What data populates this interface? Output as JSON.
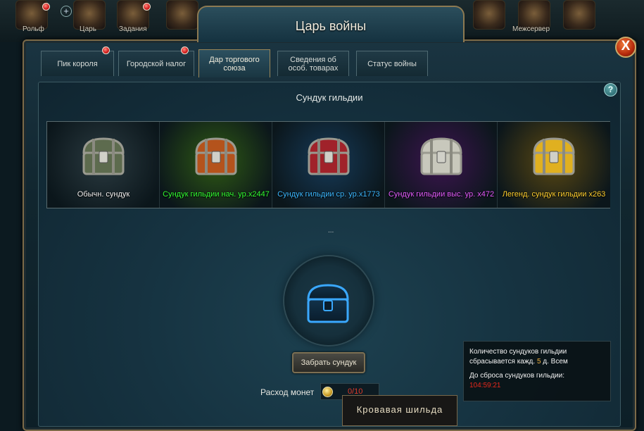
{
  "hud": {
    "labels": [
      "Рольф",
      "Царь",
      "Задания",
      "Межсервер"
    ]
  },
  "window": {
    "title": "Царь войны",
    "close_glyph": "X",
    "help_glyph": "?"
  },
  "tabs": [
    {
      "label": "Пик короля",
      "has_alert": true,
      "active": false
    },
    {
      "label": "Городской налог",
      "has_alert": true,
      "active": false
    },
    {
      "label": "Дар торгового союза",
      "has_alert": false,
      "active": true
    },
    {
      "label": "Сведения об особ. товарах",
      "has_alert": false,
      "active": false
    },
    {
      "label": "Статус войны",
      "has_alert": false,
      "active": false
    }
  ],
  "panel": {
    "title": "Сундук гильдии",
    "dots": "..."
  },
  "chests": [
    {
      "label": "Обычн. сундук",
      "label_color": "#f2f2f2",
      "bg_color": "#2a3a40",
      "chest_color": "#5d6b4e",
      "icon": "plain-chest-icon"
    },
    {
      "label": "Сундук гильдии нач. ур.x2447",
      "label_color": "#33ff33",
      "bg_color": "#2f5a14",
      "chest_color": "#b4531c",
      "icon": "green-chest-icon"
    },
    {
      "label": "Сундук гильдии ср. ур.x1773",
      "label_color": "#3cb8ff",
      "bg_color": "#163a58",
      "chest_color": "#a0222a",
      "icon": "blue-chest-icon"
    },
    {
      "label": "Сундук гильдии выс. ур. x472",
      "label_color": "#e45cff",
      "bg_color": "#3d1450",
      "chest_color": "#c8c8bc",
      "icon": "purple-chest-icon"
    },
    {
      "label": "Легенд. сундук гильдии x263",
      "label_color": "#ffd030",
      "bg_color": "#5a4812",
      "chest_color": "#e0b020",
      "icon": "legendary-chest-icon"
    }
  ],
  "actions": {
    "take_chest": "Забрать сундук",
    "cost_label": "Расход монет",
    "cost_value": "0/10"
  },
  "tooltip": "Кровавая шильда",
  "info": {
    "line1": "Количество сундуков гильдии",
    "line2_prefix": "сбрасывается кажд.",
    "line2_num": "5",
    "line2_suffix": "д. Всем",
    "line3": "До сброса сундуков гильдии:",
    "timer": "104:59:21"
  },
  "colors": {
    "accent_gold": "#8d7a52",
    "alert_red": "#d11a1a"
  }
}
